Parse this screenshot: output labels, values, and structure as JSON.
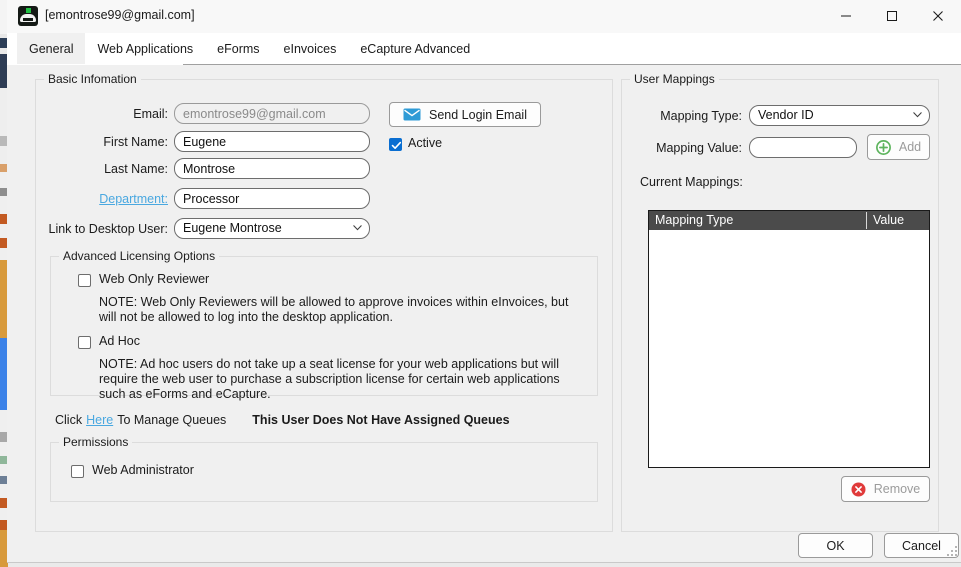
{
  "window": {
    "title": "[emontrose99@gmail.com]",
    "icon": "app-logo-icon",
    "minimize_label": "Minimize",
    "maximize_label": "Maximize",
    "close_label": "Close"
  },
  "tabs": [
    {
      "label": "General",
      "selected": true
    },
    {
      "label": "Web Applications",
      "selected": false
    },
    {
      "label": "eForms",
      "selected": false
    },
    {
      "label": "eInvoices",
      "selected": false
    },
    {
      "label": "eCapture Advanced",
      "selected": false
    }
  ],
  "basic_information": {
    "title": "Basic Infomation",
    "email_label": "Email:",
    "email_value": "emontrose99@gmail.com",
    "first_name_label": "First Name:",
    "first_name_value": "Eugene",
    "last_name_label": "Last Name:",
    "last_name_value": "Montrose",
    "department_label": "Department:",
    "department_value": "Processor",
    "link_desktop_label": "Link to Desktop User:",
    "link_desktop_value": "Eugene  Montrose",
    "send_login_email_label": "Send Login Email",
    "active_label": "Active",
    "active_checked": true
  },
  "advanced_licensing": {
    "title": "Advanced Licensing Options",
    "web_only_reviewer_label": "Web Only Reviewer",
    "web_only_reviewer_checked": false,
    "web_only_reviewer_note": "NOTE: Web Only Reviewers will be allowed to approve invoices within eInvoices, but will not be allowed to log into the desktop application.",
    "ad_hoc_label": "Ad Hoc",
    "ad_hoc_checked": false,
    "ad_hoc_note": "NOTE: Ad hoc users do not take up a seat license for your web applications but will require the web user to purchase a subscription license for certain web applications such as eForms and eCapture."
  },
  "queues": {
    "prefix": "Click",
    "link": "Here",
    "suffix": "To Manage Queues",
    "status": "This User Does Not Have Assigned Queues"
  },
  "permissions": {
    "title": "Permissions",
    "web_administrator_label": "Web Administrator",
    "web_administrator_checked": false
  },
  "user_mappings": {
    "title": "User Mappings",
    "mapping_type_label": "Mapping Type:",
    "mapping_type_value": "Vendor ID",
    "mapping_value_label": "Mapping Value:",
    "mapping_value_value": "",
    "mapping_value_placeholder": "",
    "add_label": "Add",
    "current_mappings_label": "Current Mappings:",
    "columns": [
      "Mapping Type",
      "Value"
    ],
    "rows": [],
    "remove_label": "Remove"
  },
  "footer": {
    "ok_label": "OK",
    "cancel_label": "Cancel"
  },
  "colors": {
    "accent_blue": "#0a6ed1",
    "link_blue": "#4aa8e0",
    "envelope_blue": "#2e9bd6",
    "add_green": "#5eb45e",
    "remove_red": "#e03a3a",
    "header_grey": "#4b4b4b",
    "window_bg": "#f0f0f0"
  }
}
